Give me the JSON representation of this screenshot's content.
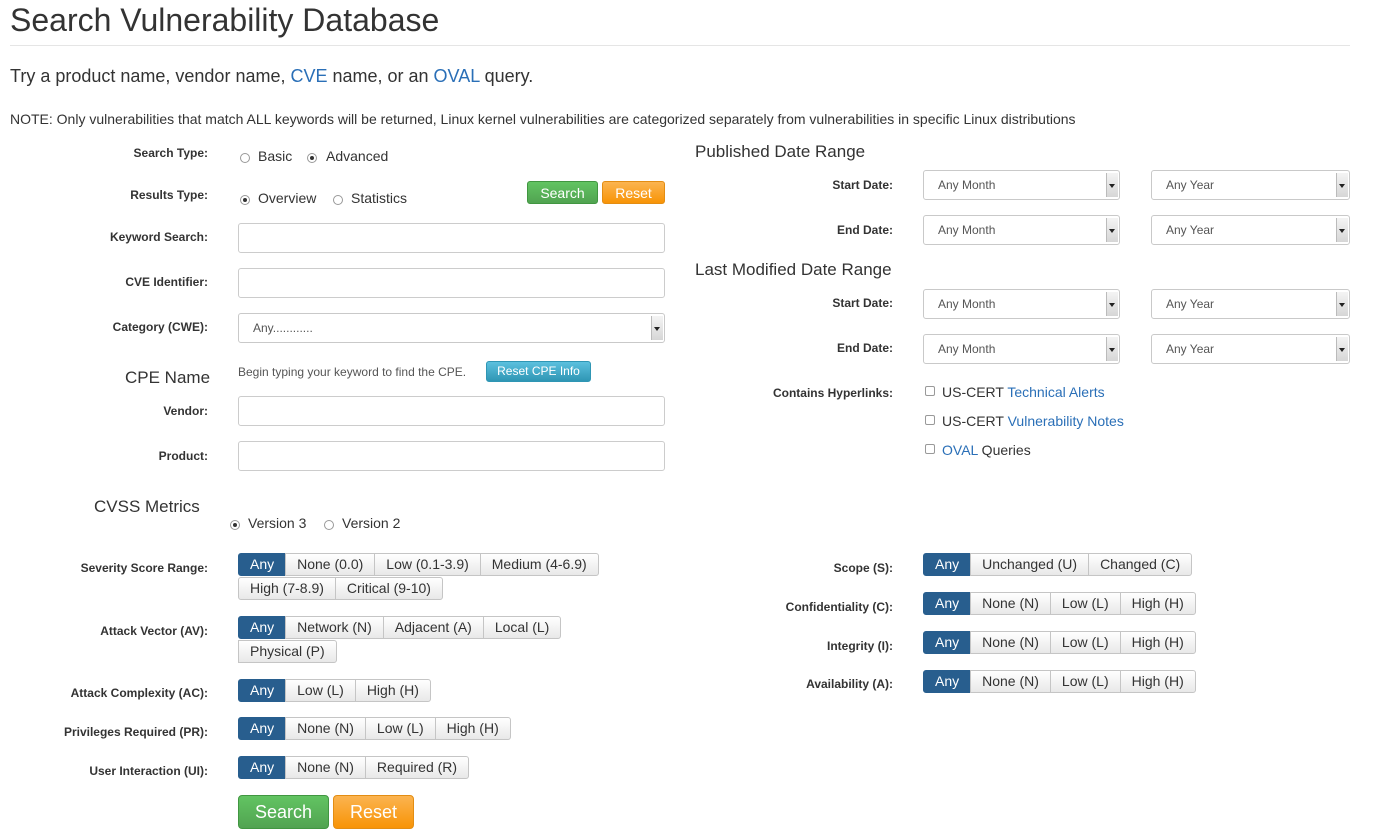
{
  "page": {
    "title": "Search Vulnerability Database",
    "intro": {
      "p1": "Try a product name, vendor name, ",
      "cve_link": "CVE",
      "p2": " name, or an ",
      "oval_link": "OVAL",
      "p3": " query."
    },
    "note": "NOTE: Only vulnerabilities that match ALL keywords will be returned, Linux kernel vulnerabilities are categorized separately from vulnerabilities in specific Linux distributions"
  },
  "form": {
    "search_type": {
      "label": "Search Type:",
      "options": [
        "Basic",
        "Advanced"
      ],
      "selected": "Advanced"
    },
    "results_type": {
      "label": "Results Type:",
      "options": [
        "Overview",
        "Statistics"
      ],
      "selected": "Overview"
    },
    "search_small": "Search",
    "reset_small": "Reset",
    "keyword": {
      "label": "Keyword Search:",
      "value": ""
    },
    "cve_id": {
      "label": "CVE Identifier:",
      "value": ""
    },
    "category": {
      "label": "Category (CWE):",
      "value": "Any............"
    },
    "cpe": {
      "heading": "CPE Name",
      "hint": "Begin typing your keyword to find the CPE.",
      "reset_button": "Reset CPE Info",
      "vendor_label": "Vendor:",
      "product_label": "Product:"
    },
    "cvss": {
      "heading": "CVSS Metrics",
      "versions": [
        "Version 3",
        "Version 2"
      ],
      "selected": "Version 3"
    },
    "severity": {
      "label": "Severity Score Range:",
      "row1": [
        "Any",
        "None (0.0)",
        "Low (0.1-3.9)",
        "Medium (4-6.9)"
      ],
      "row2": [
        "High (7-8.9)",
        "Critical (9-10)"
      ]
    },
    "attack_vector": {
      "label": "Attack Vector (AV):",
      "row1": [
        "Any",
        "Network (N)",
        "Adjacent (A)",
        "Local (L)"
      ],
      "row2": [
        "Physical (P)"
      ]
    },
    "attack_complexity": {
      "label": "Attack Complexity (AC):",
      "options": [
        "Any",
        "Low (L)",
        "High (H)"
      ]
    },
    "privileges": {
      "label": "Privileges Required (PR):",
      "options": [
        "Any",
        "None (N)",
        "Low (L)",
        "High (H)"
      ]
    },
    "user_interaction": {
      "label": "User Interaction (UI):",
      "options": [
        "Any",
        "None (N)",
        "Required (R)"
      ]
    },
    "scope": {
      "label": "Scope (S):",
      "options": [
        "Any",
        "Unchanged (U)",
        "Changed (C)"
      ]
    },
    "confidentiality": {
      "label": "Confidentiality (C):",
      "options": [
        "Any",
        "None (N)",
        "Low (L)",
        "High (H)"
      ]
    },
    "integrity": {
      "label": "Integrity (I):",
      "options": [
        "Any",
        "None (N)",
        "Low (L)",
        "High (H)"
      ]
    },
    "availability": {
      "label": "Availability (A):",
      "options": [
        "Any",
        "None (N)",
        "Low (L)",
        "High (H)"
      ]
    },
    "published": {
      "heading": "Published Date Range",
      "start_label": "Start Date:",
      "end_label": "End Date:",
      "start_month": "Any Month",
      "start_year": "Any Year",
      "end_month": "Any Month",
      "end_year": "Any Year"
    },
    "modified": {
      "heading": "Last Modified Date Range",
      "start_label": "Start Date:",
      "end_label": "End Date:",
      "start_month": "Any Month",
      "start_year": "Any Year",
      "end_month": "Any Month",
      "end_year": "Any Year"
    },
    "hyperlinks": {
      "label": "Contains Hyperlinks:",
      "opt1": {
        "prefix": "US-CERT ",
        "link": "Technical Alerts"
      },
      "opt2": {
        "prefix": "US-CERT ",
        "link": "Vulnerability Notes"
      },
      "opt3": {
        "link": "OVAL",
        "suffix": " Queries"
      }
    },
    "search_large": "Search",
    "reset_large": "Reset"
  },
  "colors": {
    "accent_link": "#2a6fb7",
    "active_segment": "#285e8e",
    "search_green": "#51a351",
    "reset_orange": "#f89406",
    "cpe_cyan": "#2f96b4"
  }
}
